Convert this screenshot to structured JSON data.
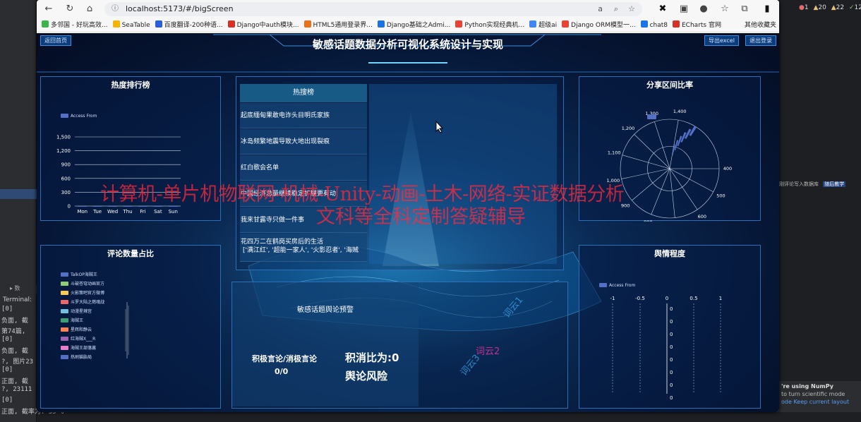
{
  "browser": {
    "url": "localhost:5173/#/bigScreen",
    "bookmarks": [
      "多邻国 - 好玩高效...",
      "SeaTable",
      "百度翻译-200种语...",
      "Django中auth模块...",
      "HTML5通用登录界...",
      "Django基础之Admi...",
      "Python实现经典机...",
      "超级ai",
      "Django ORM模型一...",
      "chat8",
      "ECharts 官网"
    ],
    "other_bookmarks": "其他收藏夹",
    "bookmark_colors": [
      "#3bb54a",
      "#f4b400",
      "#2b5ed8",
      "#d93025",
      "#e8711a",
      "#1a73e8",
      "#ea4335",
      "#4285f4",
      "#ea4335",
      "#1a73e8",
      "#d93025"
    ]
  },
  "screen": {
    "title": "敏感话题数据分析可视化系统设计与实现",
    "btn_home": "返回首页",
    "btn_export": "导出excel",
    "btn_logout": "退出登录"
  },
  "heat_rank": {
    "title": "热度排行榜",
    "legend": "Access From",
    "chart_data": {
      "type": "bar",
      "categories": [
        "Mon",
        "Tue",
        "Wed",
        "Thu",
        "Fri",
        "Sat",
        "Sun"
      ],
      "series": [
        {
          "name": "Access From",
          "values": [
            0,
            0,
            0,
            0,
            0,
            0,
            0
          ]
        }
      ],
      "yticks": [
        "0",
        "300",
        "600",
        "900",
        "1,200",
        "1,500"
      ],
      "ylim": [
        0,
        1500
      ]
    }
  },
  "hot_search": {
    "header": "热搜榜",
    "items": [
      "起底缅甸果敢电诈头目明氏家族",
      "冰岛频繁地震导致大地出现裂痕",
      "红白歌会名单",
      "中国经济总量继续稳定扩展更有动",
      "我来甘露寺只做一件事",
      "花四万二在鹤岗买房后的生活"
    ],
    "tags": "['满江红', '超能一家人', '火影忍者', '海贼"
  },
  "share_ratio": {
    "title": "分享区间比率",
    "chart_data": {
      "type": "polar-bar",
      "ticks": [
        "1,400",
        "1,300",
        "1,200",
        "1,100",
        "1,000",
        "900",
        "800",
        "700",
        "600",
        "500",
        "400"
      ]
    }
  },
  "comment_ratio": {
    "title": "评论数量占比",
    "legend": [
      {
        "name": "TalkOP海贼王",
        "color": "#5470c6"
      },
      {
        "name": "斗破苍穹动画官方",
        "color": "#91cc75"
      },
      {
        "name": "火影策吧官方微博",
        "color": "#fac858"
      },
      {
        "name": "斗罗大陆之燃魂战",
        "color": "#ee6666"
      },
      {
        "name": "动漫星辣宫",
        "color": "#73c0de"
      },
      {
        "name": "海贼王",
        "color": "#3ba272"
      },
      {
        "name": "星辉和静云",
        "color": "#fc8452"
      },
      {
        "name": "红海贼X___R",
        "color": "#9a60b4"
      },
      {
        "name": "海贼王部落酱",
        "color": "#ea7ccc"
      },
      {
        "name": "热刷猫胎局",
        "color": "#5470c6"
      }
    ]
  },
  "warning": {
    "title": "敏感话题舆论预警",
    "pos_neg_label": "积极言论/消极言论",
    "pos_neg_value": "0/0",
    "ratio_label": "积消比为:0",
    "risk_label": "舆论风险"
  },
  "sentiment": {
    "title": "舆情程度",
    "legend": "Access From",
    "xticks": [
      "-1",
      "-0.5",
      "0",
      "0.5",
      "1"
    ],
    "values": [
      "0",
      "0",
      "0",
      "0",
      "0",
      "0",
      "0",
      "0"
    ]
  },
  "map_labels": [
    "词云1",
    "词云2",
    "词云3"
  ],
  "watermark": {
    "line1": "计算机-单片机物联网-机械-Unity-动画-土木-网络-实证数据分析",
    "line2": "文科等全科定制答疑辅导"
  },
  "ide": {
    "right_label": "刚评论写入数据库",
    "right_badge": "随后教学",
    "numpy_title": "'re using NumPy",
    "numpy_text": "to turn scientific mode",
    "numpy_link1": "ode",
    "numpy_link2": "Keep current layout",
    "counters": [
      "1",
      "20",
      "22",
      "12"
    ],
    "terminal_title": "Terminal:",
    "console_lines": [
      "[0]",
      "负面, 截",
      "第74篇,",
      "[0]",
      "负面, 截",
      "?, 图片23",
      "[0]",
      "正面, 截",
      "?, 23111",
      "[0]",
      "正面, 截率为: 35 %"
    ]
  }
}
